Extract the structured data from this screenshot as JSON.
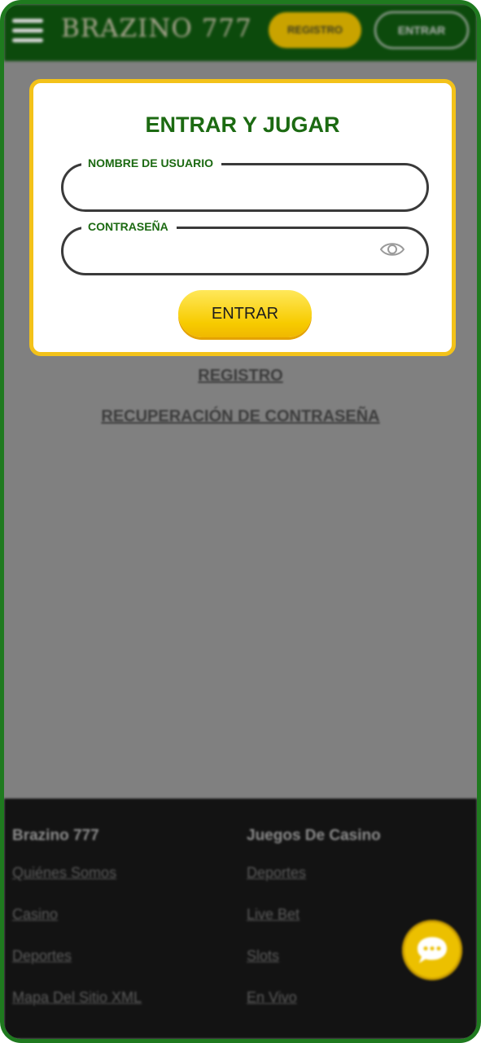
{
  "header": {
    "menu_icon": "hamburger-menu-icon",
    "logo": "BRAZINO 777",
    "registro_label": "REGISTRO",
    "entrar_label": "ENTRAR"
  },
  "modal": {
    "title": "ENTRAR Y JUGAR",
    "username_label": "NOMBRE DE USUARIO",
    "username_value": "",
    "password_label": "CONTRASEÑA",
    "password_value": "",
    "eye_icon": "eye-icon",
    "submit_label": "ENTRAR"
  },
  "links": {
    "registro": "REGISTRO",
    "recuperacion": "RECUPERACIÓN DE CONTRASEÑA"
  },
  "footer": {
    "col1_heading": "Brazino 777",
    "col1_links": [
      "Quiénes Somos",
      "Casino",
      "Deportes",
      "Mapa Del Sitio XML"
    ],
    "col2_heading": "Juegos De Casino",
    "col2_links": [
      "Deportes",
      "Live Bet",
      "Slots",
      "En Vivo"
    ]
  },
  "chat": {
    "icon": "chat-bubble-icon"
  },
  "colors": {
    "brand_green": "#0c4a0c",
    "title_green": "#1c6a12",
    "accent_yellow": "#f7cb00",
    "modal_border": "#f3c21a",
    "overlay": "#808080",
    "footer_bg": "#131313"
  }
}
